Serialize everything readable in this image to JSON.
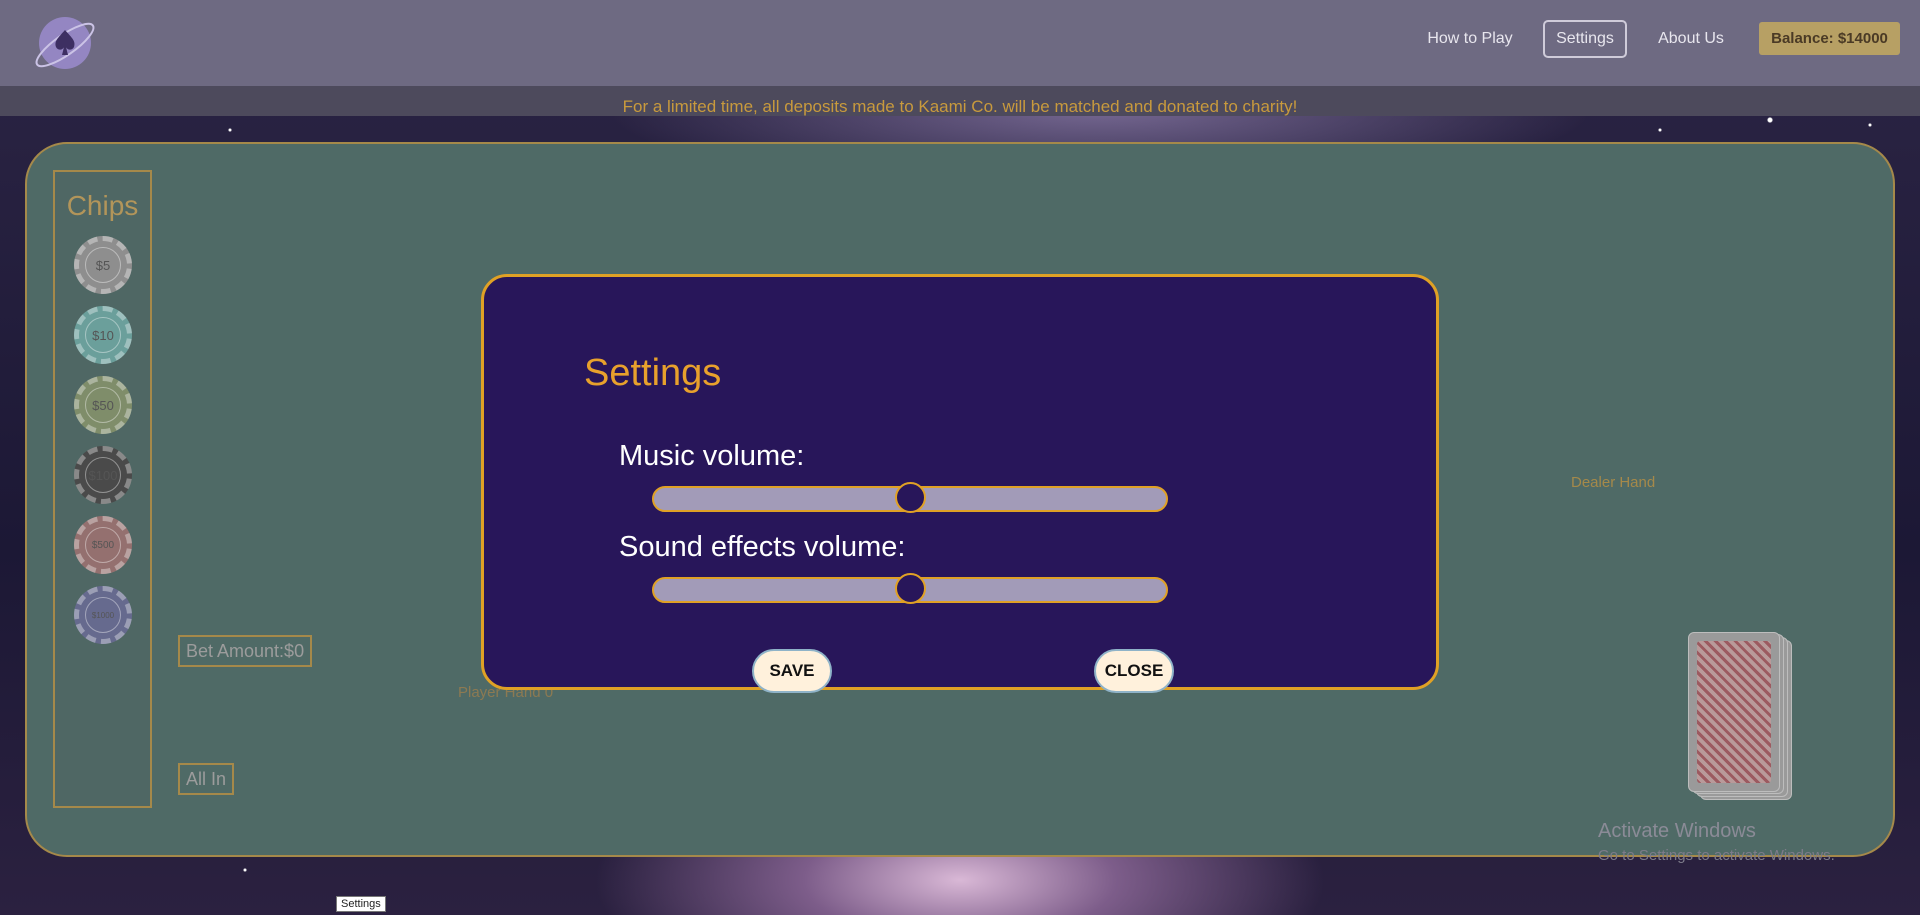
{
  "nav": {
    "how_to_play": "How to Play",
    "settings": "Settings",
    "about_us": "About Us",
    "balance": "Balance: $14000"
  },
  "banner": "For a limited time, all deposits made to Kaami Co. will be matched and donated to charity!",
  "chips": {
    "title": "Chips",
    "items": [
      "$5",
      "$10",
      "$50",
      "$100",
      "$500",
      "$1000"
    ]
  },
  "bet_amount": "Bet Amount:$0",
  "all_in": "All In",
  "player_hand": "Player Hand  0",
  "dealer_hand": "Dealer Hand",
  "settings_modal": {
    "title": "Settings",
    "music_label": "Music volume:",
    "music_level": 0.5,
    "sfx_label": "Sound effects volume:",
    "sfx_level": 0.5,
    "save": "SAVE",
    "close": "CLOSE"
  },
  "windows": {
    "activate": "Activate Windows",
    "activate_sub": "Go to Settings to activate Windows."
  },
  "tooltip": "Settings",
  "colors": {
    "modal_bg": "#28165a",
    "accent": "#e0a125",
    "table_felt": "#4f6a66"
  }
}
